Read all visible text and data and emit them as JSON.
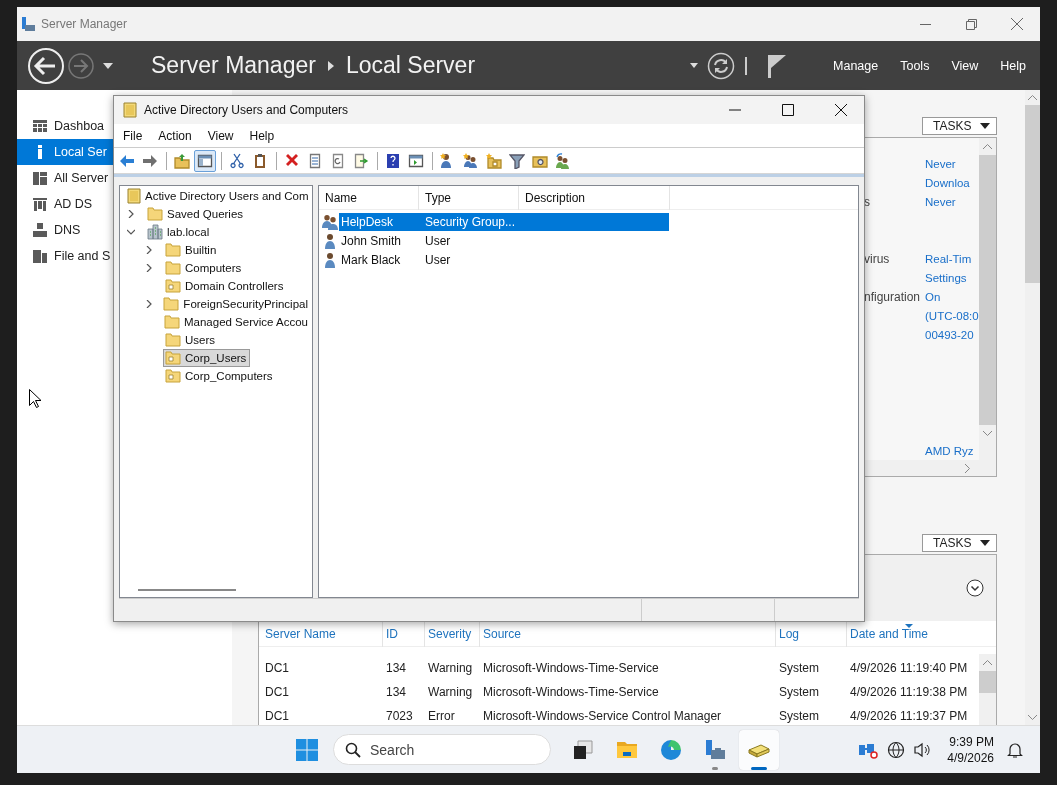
{
  "server_manager": {
    "window_title": "Server Manager",
    "breadcrumb": [
      "Server Manager",
      "Local Server"
    ],
    "menu": [
      "Manage",
      "Tools",
      "View",
      "Help"
    ],
    "sidebar": [
      {
        "label": "Dashboa",
        "selected": false
      },
      {
        "label": "Local Ser",
        "selected": true
      },
      {
        "label": "All Server",
        "selected": false
      },
      {
        "label": "AD DS",
        "selected": false
      },
      {
        "label": "DNS",
        "selected": false
      },
      {
        "label": "File and S",
        "selected": false
      }
    ],
    "properties": {
      "tasks_label": "TASKS",
      "groups": [
        [
          {
            "value": "Never"
          },
          {
            "value": "Downloa"
          },
          {
            "label": "s",
            "value": "Never"
          }
        ],
        [
          {
            "label": "virus",
            "value": "Real-Tim"
          },
          {
            "value": "Settings"
          },
          {
            "label": "nfiguration",
            "value": "On"
          },
          {
            "value": "(UTC-08:0"
          },
          {
            "value": "00493-20"
          }
        ],
        [
          {
            "value": "AMD Ryz"
          }
        ]
      ]
    },
    "events": {
      "tasks_label": "TASKS",
      "columns": [
        {
          "label": "Server Name",
          "sorted": false
        },
        {
          "label": "ID",
          "sorted": false
        },
        {
          "label": "Severity",
          "sorted": false
        },
        {
          "label": "Source",
          "sorted": false
        },
        {
          "label": "Log",
          "sorted": false
        },
        {
          "label": "Date and Time",
          "sorted": true
        }
      ],
      "rows": [
        [
          "DC1",
          "134",
          "Warning",
          "Microsoft-Windows-Time-Service",
          "System",
          "4/9/2026 11:19:40 PM"
        ],
        [
          "DC1",
          "134",
          "Warning",
          "Microsoft-Windows-Time-Service",
          "System",
          "4/9/2026 11:19:38 PM"
        ],
        [
          "DC1",
          "7023",
          "Error",
          "Microsoft-Windows-Service Control Manager",
          "System",
          "4/9/2026 11:19:37 PM"
        ]
      ]
    }
  },
  "aduc": {
    "window_title": "Active Directory Users and Computers",
    "menu": [
      "File",
      "Action",
      "View",
      "Help"
    ],
    "toolbar": {
      "console_tree_on": true
    },
    "tree": [
      {
        "label": "Active Directory Users and Com",
        "kind": "root",
        "selected": false,
        "children": [
          {
            "label": "Saved Queries",
            "kind": "folder",
            "expanded": false,
            "selected": false
          },
          {
            "label": "lab.local",
            "kind": "domain",
            "expanded": true,
            "selected": false,
            "children": [
              {
                "label": "Builtin",
                "kind": "folder",
                "expanded": false,
                "selected": false
              },
              {
                "label": "Computers",
                "kind": "folder",
                "expanded": false,
                "selected": false
              },
              {
                "label": "Domain Controllers",
                "kind": "ou",
                "selected": false
              },
              {
                "label": "ForeignSecurityPrincipal",
                "kind": "folder",
                "expanded": false,
                "selected": false
              },
              {
                "label": "Managed Service Accou",
                "kind": "folder",
                "selected": false
              },
              {
                "label": "Users",
                "kind": "folder",
                "selected": false
              },
              {
                "label": "Corp_Users",
                "kind": "ou",
                "selected": true
              },
              {
                "label": "Corp_Computers",
                "kind": "ou",
                "selected": false
              }
            ]
          }
        ]
      }
    ],
    "list": {
      "columns": [
        "Name",
        "Type",
        "Description"
      ],
      "rows": [
        {
          "kind": "group",
          "name": "HelpDesk",
          "type": "Security Group...",
          "selected": true
        },
        {
          "kind": "user",
          "name": "John Smith",
          "type": "User",
          "selected": false
        },
        {
          "kind": "user",
          "name": "Mark Black",
          "type": "User",
          "selected": false
        }
      ]
    }
  },
  "taskbar": {
    "search_placeholder": "Search",
    "apps": [
      {
        "running": false,
        "active": false
      },
      {
        "running": false,
        "active": false
      },
      {
        "running": false,
        "active": false
      },
      {
        "running": true,
        "active": false
      },
      {
        "running": true,
        "active": true
      }
    ],
    "time": "9:39 PM",
    "date": "4/9/2026"
  }
}
